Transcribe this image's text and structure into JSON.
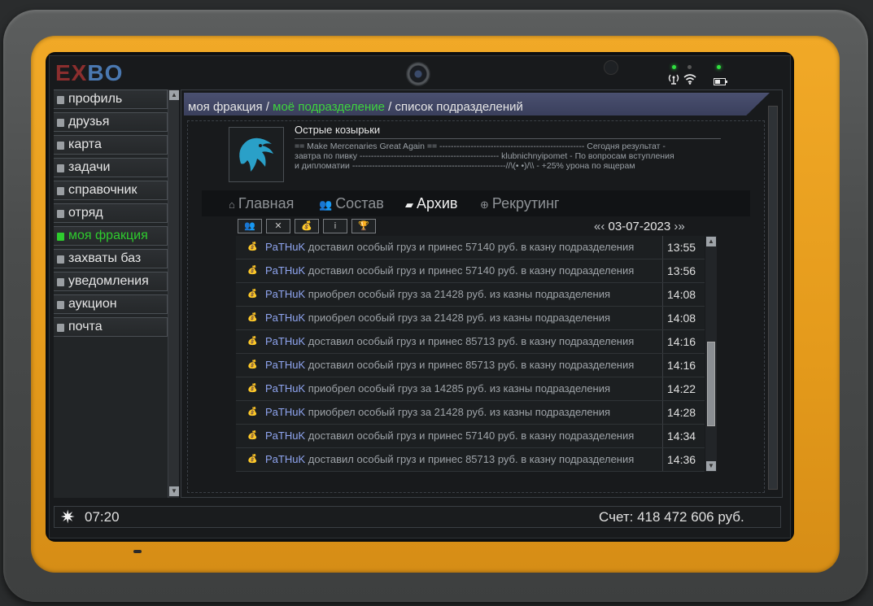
{
  "logo": {
    "part1": "EX",
    "part2": "BO"
  },
  "status": {
    "signal_icon": "antenna-icon",
    "wifi_icon": "wifi-icon",
    "battery_icon": "battery-icon"
  },
  "sidebar": {
    "items": [
      {
        "label": "профиль",
        "active": false
      },
      {
        "label": "друзья",
        "active": false
      },
      {
        "label": "карта",
        "active": false
      },
      {
        "label": "задачи",
        "active": false
      },
      {
        "label": "справочник",
        "active": false
      },
      {
        "label": "отряд",
        "active": false
      },
      {
        "label": "моя фракция",
        "active": true
      },
      {
        "label": "захваты баз",
        "active": false
      },
      {
        "label": "уведомления",
        "active": false
      },
      {
        "label": "аукцион",
        "active": false
      },
      {
        "label": "почта",
        "active": false
      }
    ]
  },
  "breadcrumb": {
    "part1": "моя фракция",
    "sep1": " / ",
    "part2": "моё подразделение",
    "sep2": " / ",
    "part3": "список подразделений"
  },
  "faction": {
    "name": "Острые козырьки",
    "description": "== Make Mercenaries Great Again == --------------------------------------------------- Сегодня результат - завтра по пивку ------------------------------------------------- klubnichnyipomet - По вопросам вступления и дипломатии ------------------------------------------------------//\\(• •)/\\\\ - +25% урона по ящерам"
  },
  "tabs": [
    {
      "label": "Главная",
      "icon": "home-icon",
      "glyph": "⌂",
      "active": false
    },
    {
      "label": "Состав",
      "icon": "members-icon",
      "glyph": "👥",
      "active": false
    },
    {
      "label": "Архив",
      "icon": "folder-icon",
      "glyph": "▰",
      "active": true
    },
    {
      "label": "Рекрутинг",
      "icon": "recruit-icon",
      "glyph": "⊕",
      "active": false
    }
  ],
  "toolbar": {
    "filters": [
      {
        "icon": "members-filter-icon",
        "glyph": "👥"
      },
      {
        "icon": "crossed-swords-icon",
        "glyph": "✕"
      },
      {
        "icon": "money-bag-icon",
        "glyph": "💰"
      },
      {
        "icon": "info-icon",
        "glyph": "i"
      },
      {
        "icon": "trophy-icon",
        "glyph": "🏆"
      }
    ],
    "prev_arrow": "«‹",
    "date": "03-07-2023",
    "next_arrow": "›»"
  },
  "log": [
    {
      "player": "PaTHuK",
      "text": " доставил особый груз и принес 57140 руб. в казну подразделения",
      "time": "13:55"
    },
    {
      "player": "PaTHuK",
      "text": " доставил особый груз и принес 57140 руб. в казну подразделения",
      "time": "13:56"
    },
    {
      "player": "PaTHuK",
      "text": " приобрел особый груз за 21428 руб. из казны подразделения",
      "time": "14:08"
    },
    {
      "player": "PaTHuK",
      "text": " приобрел особый груз за 21428 руб. из казны подразделения",
      "time": "14:08"
    },
    {
      "player": "PaTHuK",
      "text": " доставил особый груз и принес 85713 руб. в казну подразделения",
      "time": "14:16"
    },
    {
      "player": "PaTHuK",
      "text": " доставил особый груз и принес 85713 руб. в казну подразделения",
      "time": "14:16"
    },
    {
      "player": "PaTHuK",
      "text": " приобрел особый груз за 14285 руб. из казны подразделения",
      "time": "14:22"
    },
    {
      "player": "PaTHuK",
      "text": " приобрел особый груз за 21428 руб. из казны подразделения",
      "time": "14:28"
    },
    {
      "player": "PaTHuK",
      "text": " доставил особый груз и принес 57140 руб. в казну подразделения",
      "time": "14:34"
    },
    {
      "player": "PaTHuK",
      "text": " доставил особый груз и принес 85713 руб. в казну подразделения",
      "time": "14:36"
    }
  ],
  "bottom": {
    "time": "07:20",
    "account": "Счет: 418 472 606 руб."
  },
  "colors": {
    "accent_green": "#3ed43e",
    "player_blue": "#8fa5f0",
    "shell_orange": "#e49a1b"
  }
}
